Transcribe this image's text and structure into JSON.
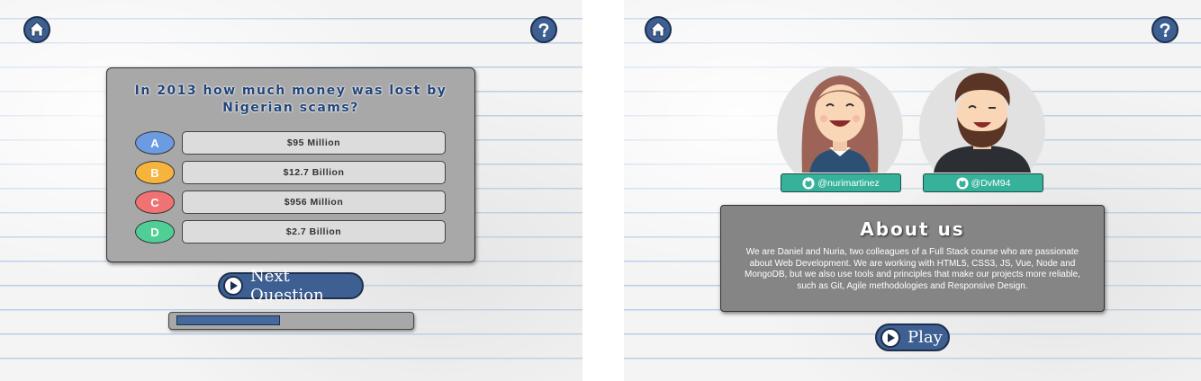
{
  "quiz_screen": {
    "question": "In 2013 how much money was lost by Nigerian scams?",
    "options": [
      {
        "letter": "A",
        "text": "$95 Million",
        "color": "#6b9be0"
      },
      {
        "letter": "B",
        "text": "$12.7 Billion",
        "color": "#f6b43c"
      },
      {
        "letter": "C",
        "text": "$956 Million",
        "color": "#f07272"
      },
      {
        "letter": "D",
        "text": "$2.7 Billion",
        "color": "#4fcf95"
      }
    ],
    "next_label": "Next Question",
    "progress_fraction": 0.45
  },
  "about_screen": {
    "profiles": [
      {
        "handle": "@nurimartinez"
      },
      {
        "handle": "@DvM94"
      }
    ],
    "title": "About us",
    "body": "We are Daniel and Nuria, two colleagues of a Full Stack course who are passionate about Web Development. We are working with HTML5, CSS3, JS, Vue, Node and MongoDB, but we also use tools and principles that make our projects more reliable, such as Git, Agile methodologies and Responsive Design.",
    "play_label": "Play"
  },
  "icons": [
    "home-icon",
    "help-icon",
    "play-icon",
    "github-icon"
  ],
  "colors": {
    "button": "#3d5f91",
    "tag": "#36b29a",
    "question_text": "#22457a"
  }
}
